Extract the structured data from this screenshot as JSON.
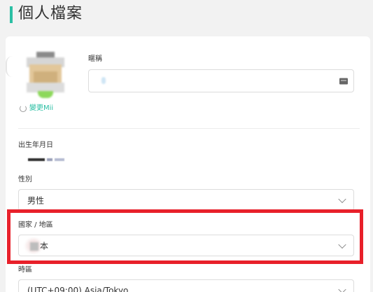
{
  "page": {
    "title": "個人檔案"
  },
  "profile": {
    "change_avatar_label": "變更Mii",
    "nickname": {
      "label": "暱稱",
      "value": ""
    },
    "birthdate": {
      "label": "出生年月日"
    },
    "gender": {
      "label": "性別",
      "value": "男性"
    },
    "country": {
      "label": "國家 / 地區",
      "value_suffix": "本"
    },
    "timezone": {
      "label": "時區",
      "value": "(UTC+09:00) Asia/Tokyo"
    }
  },
  "colors": {
    "accent": "#2bbfa4",
    "highlight": "#e8202a"
  },
  "icons": {
    "refresh": "refresh-icon",
    "chevron": "chevron-down-icon",
    "card": "id-card-icon"
  }
}
